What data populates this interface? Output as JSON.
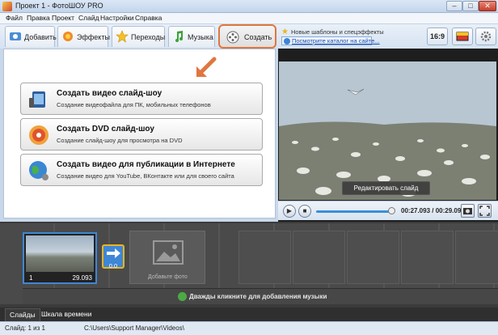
{
  "window": {
    "title": "Проект 1 - ФотоШОУ PRO",
    "min": "–",
    "max": "□",
    "close": "✕"
  },
  "menu": [
    "Файл",
    "Правка",
    "Проект",
    "Слайд",
    "Настройки",
    "Справка"
  ],
  "tabs": [
    {
      "label": "Добавить",
      "icon": "add-photo-icon"
    },
    {
      "label": "Эффекты",
      "icon": "effects-icon"
    },
    {
      "label": "Переходы",
      "icon": "star-icon"
    },
    {
      "label": "Музыка",
      "icon": "music-note-icon"
    },
    {
      "label": "Создать",
      "icon": "film-reel-icon",
      "active": true
    }
  ],
  "news": {
    "title": "Новые шаблоны и спецэффекты",
    "link": "Посмотрите каталог на сайте..."
  },
  "toolbar": {
    "ratio": "16:9"
  },
  "create_options": [
    {
      "title": "Создать видео слайд-шоу",
      "subtitle": "Создание видеофайла для ПК, мобильных телефонов",
      "icon": "video-device-icon"
    },
    {
      "title": "Создать DVD слайд-шоу",
      "subtitle": "Создание слайд-шоу для просмотра на DVD",
      "icon": "dvd-disc-icon"
    },
    {
      "title": "Создать видео для публикации в Интернете",
      "subtitle": "Создание видео для YouTube, ВКонтакте или для своего сайта",
      "icon": "globe-icon"
    }
  ],
  "preview": {
    "edit_label": "Редактировать слайд",
    "time": "00:27.093 / 00:29.093",
    "progress": 0.93
  },
  "timeline": {
    "slide": {
      "number": "1",
      "duration": "29.093"
    },
    "transition": {
      "duration": "0.0"
    },
    "add_photo": "Добавьте фото",
    "music_hint": "Дважды кликните для добавления музыки"
  },
  "bottom_tabs": [
    "Слайды",
    "Шкала времени"
  ],
  "status": {
    "slide": "Слайд: 1 из 1",
    "path": "C:\\Users\\Support Manager\\Videos\\"
  },
  "colors": {
    "accent": "#e0763f",
    "selection": "#3f86d6",
    "transition_border": "#e8b51f"
  }
}
